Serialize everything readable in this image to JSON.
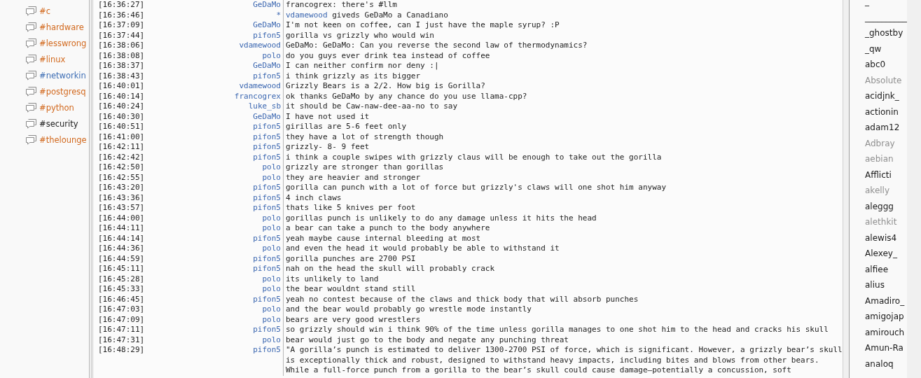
{
  "channels": [
    {
      "name": "#c",
      "color": "#d2691e"
    },
    {
      "name": "#hardware",
      "color": "#d2691e"
    },
    {
      "name": "#lesswrong",
      "color": "#d2691e"
    },
    {
      "name": "#linux",
      "color": "#d2691e"
    },
    {
      "name": "#networkin",
      "color": "#3f6fb5"
    },
    {
      "name": "#postgresq",
      "color": "#d2691e"
    },
    {
      "name": "#python",
      "color": "#d2691e"
    },
    {
      "name": "#security",
      "color": "#222222"
    },
    {
      "name": "#thelounge",
      "color": "#d2691e"
    }
  ],
  "messages": [
    {
      "kind": "message",
      "time": "[16:36:27]",
      "nick": "GeDaMo",
      "text": "francogrex: there's #llm"
    },
    {
      "kind": "action",
      "time": "[16:36:46]",
      "nick": "*",
      "actor": "vdamewood",
      "text": "giveds GeDaMo a Canadiano"
    },
    {
      "kind": "message",
      "time": "[16:37:09]",
      "nick": "GeDaMo",
      "text": "I'm not keen on coffee, can I just have the maple syrup? :P"
    },
    {
      "kind": "message",
      "time": "[16:37:44]",
      "nick": "pifon5",
      "text": "gorilla vs grizzly who would win"
    },
    {
      "kind": "message",
      "time": "[16:38:06]",
      "nick": "vdamewood",
      "text": "GeDaMo: GeDaMo: Can you reverse the second law of thermodynamics?"
    },
    {
      "kind": "message",
      "time": "[16:38:08]",
      "nick": "polo",
      "text": "do you guys ever drink tea instead of coffee"
    },
    {
      "kind": "message",
      "time": "[16:38:37]",
      "nick": "GeDaMo",
      "text": "I can neither confirm nor deny :|"
    },
    {
      "kind": "message",
      "time": "[16:38:43]",
      "nick": "pifon5",
      "text": "i think grizzly as its bigger"
    },
    {
      "kind": "message",
      "time": "[16:40:01]",
      "nick": "vdamewood",
      "text": "Grizzly Bears is a 2/2. How big is Gorilla?"
    },
    {
      "kind": "message",
      "time": "[16:40:14]",
      "nick": "francogrex",
      "text": "ok thanks GeDaMo by any chance do you use llama-cpp?"
    },
    {
      "kind": "message",
      "time": "[16:40:24]",
      "nick": "luke_sb",
      "text": "it should be Caw-naw-dee-aa-no to say"
    },
    {
      "kind": "message",
      "time": "[16:40:30]",
      "nick": "GeDaMo",
      "text": "I have not used it"
    },
    {
      "kind": "message",
      "time": "[16:40:51]",
      "nick": "pifon5",
      "text": "girillas are 5-6 feet only"
    },
    {
      "kind": "message",
      "time": "[16:41:00]",
      "nick": "pifon5",
      "text": "they have a lot of strength though"
    },
    {
      "kind": "message",
      "time": "[16:42:11]",
      "nick": "pifon5",
      "text": "grizzly- 8- 9 feet"
    },
    {
      "kind": "message",
      "time": "[16:42:42]",
      "nick": "pifon5",
      "text": "i think a couple swipes with grizzly claus will be enough to take out the gorilla"
    },
    {
      "kind": "message",
      "time": "[16:42:50]",
      "nick": "polo",
      "text": "grizzly are stronger than gorillas"
    },
    {
      "kind": "message",
      "time": "[16:42:55]",
      "nick": "polo",
      "text": "they are heavier and stronger"
    },
    {
      "kind": "message",
      "time": "[16:43:20]",
      "nick": "pifon5",
      "text": "gorilla can punch with a lot of force but grizzly's claws will one shot him anyway"
    },
    {
      "kind": "message",
      "time": "[16:43:36]",
      "nick": "pifon5",
      "text": "4 inch claws"
    },
    {
      "kind": "message",
      "time": "[16:43:57]",
      "nick": "pifon5",
      "text": "thats like 5 knives per foot"
    },
    {
      "kind": "message",
      "time": "[16:44:00]",
      "nick": "polo",
      "text": "gorillas punch is unlikely to do any damage unless it hits the head"
    },
    {
      "kind": "message",
      "time": "[16:44:11]",
      "nick": "polo",
      "text": "a bear can take a punch to the body anywhere"
    },
    {
      "kind": "message",
      "time": "[16:44:14]",
      "nick": "pifon5",
      "text": "yeah maybe cause internal bleeding at most"
    },
    {
      "kind": "message",
      "time": "[16:44:36]",
      "nick": "polo",
      "text": "and even the head it would probably be able to withstand it"
    },
    {
      "kind": "message",
      "time": "[16:44:59]",
      "nick": "pifon5",
      "text": "gorilla punches are 2700 PSI"
    },
    {
      "kind": "message",
      "time": "[16:45:11]",
      "nick": "pifon5",
      "text": "nah on the head the skull will probably crack"
    },
    {
      "kind": "message",
      "time": "[16:45:28]",
      "nick": "polo",
      "text": "its unlikely to land"
    },
    {
      "kind": "message",
      "time": "[16:45:33]",
      "nick": "polo",
      "text": "the bear wouldnt stand still"
    },
    {
      "kind": "message",
      "time": "[16:46:45]",
      "nick": "pifon5",
      "text": "yeah no contest because of the claws and thick body that will absorb punches"
    },
    {
      "kind": "message",
      "time": "[16:47:03]",
      "nick": "polo",
      "text": "and the bear would probably go wrestle mode instantly"
    },
    {
      "kind": "message",
      "time": "[16:47:09]",
      "nick": "polo",
      "text": "bears are very good wrestlers"
    },
    {
      "kind": "message",
      "time": "[16:47:11]",
      "nick": "pifon5",
      "text": "so grizzly should win i think 90% of the time unless gorilla manages to one shot him to the head and cracks his skull"
    },
    {
      "kind": "message",
      "time": "[16:47:31]",
      "nick": "polo",
      "text": "bear would just go to the body and negate any punching threat"
    },
    {
      "kind": "message",
      "time": "[16:48:29]",
      "nick": "pifon5",
      "text": "\"A gorilla’s punch is estimated to deliver 1300-2700 PSI of force, which is significant. However, a grizzly bear’s skull is exceptionally thick and robust, designed to withstand heavy impacts, including bites and blows from other bears. While a full-force punch from a gorilla to the bear’s skull could cause damage—potentially a concussion, soft"
    }
  ],
  "users": [
    {
      "name": "_",
      "away": false
    },
    {
      "name": "__________",
      "away": false
    },
    {
      "name": "_ghostby",
      "away": false
    },
    {
      "name": "_qw",
      "away": false
    },
    {
      "name": "abc0",
      "away": false
    },
    {
      "name": "Absolute",
      "away": true
    },
    {
      "name": "acidjnk_",
      "away": false
    },
    {
      "name": "actionin",
      "away": false
    },
    {
      "name": "adam12",
      "away": false
    },
    {
      "name": "Adbray",
      "away": true
    },
    {
      "name": "aebian",
      "away": true
    },
    {
      "name": "Afflicti",
      "away": false
    },
    {
      "name": "akelly",
      "away": true
    },
    {
      "name": "aleggg",
      "away": false
    },
    {
      "name": "alethkit",
      "away": true
    },
    {
      "name": "alewis4",
      "away": false
    },
    {
      "name": "Alexey_",
      "away": false
    },
    {
      "name": "alfiee",
      "away": false
    },
    {
      "name": "alius",
      "away": false
    },
    {
      "name": "Amadiro_",
      "away": false
    },
    {
      "name": "amigojap",
      "away": false
    },
    {
      "name": "amirouch",
      "away": false
    },
    {
      "name": "Amun-Ra",
      "away": false
    },
    {
      "name": "analoq",
      "away": false
    }
  ]
}
